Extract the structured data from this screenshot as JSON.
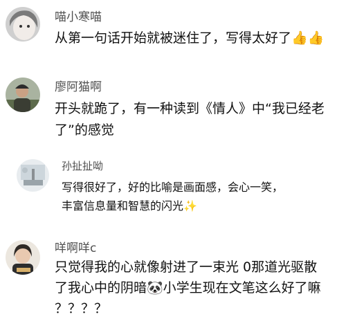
{
  "comments": [
    {
      "username": "喵小寒喵",
      "lines": [
        "从第一句话开始就被迷住了，写得太好了👍👍"
      ]
    },
    {
      "username": "廖阿猫啊",
      "lines": [
        "开头就跪了，有一种读到《情人》中“我已经老",
        "了”的感觉"
      ]
    },
    {
      "username": "孙扯扯呦",
      "lines": [
        "写得很好了，好的比喻是画面感，会心一笑，",
        "丰富信息量和智慧的闪光✨"
      ]
    },
    {
      "username": "咩啊咩c",
      "lines": [
        "只觉得我的心就像射进了一束光 0那道光驱散",
        "了我心中的阴暗🐼小学生现在文笔这么好了嘛",
        "？？？？"
      ]
    }
  ]
}
